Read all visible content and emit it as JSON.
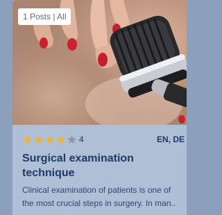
{
  "card": {
    "badge": "1 Posts | All",
    "rating": {
      "filled_stars": 4,
      "total_stars": 5,
      "value": "4",
      "filled_color": "#f0b52c",
      "empty_color": "#8c97a6"
    },
    "languages": "EN, DE",
    "title_line1": "Surgical examination",
    "title_line2": "technique",
    "description_line1": "Clinical examination of patients is one of",
    "description_line2": "the most crucial steps in surgery. In man..",
    "image_alt": "stethoscope-examination-photo"
  },
  "colors": {
    "card_bg": "#aebfd6",
    "title": "#1f3a66",
    "text": "#2e4670"
  }
}
